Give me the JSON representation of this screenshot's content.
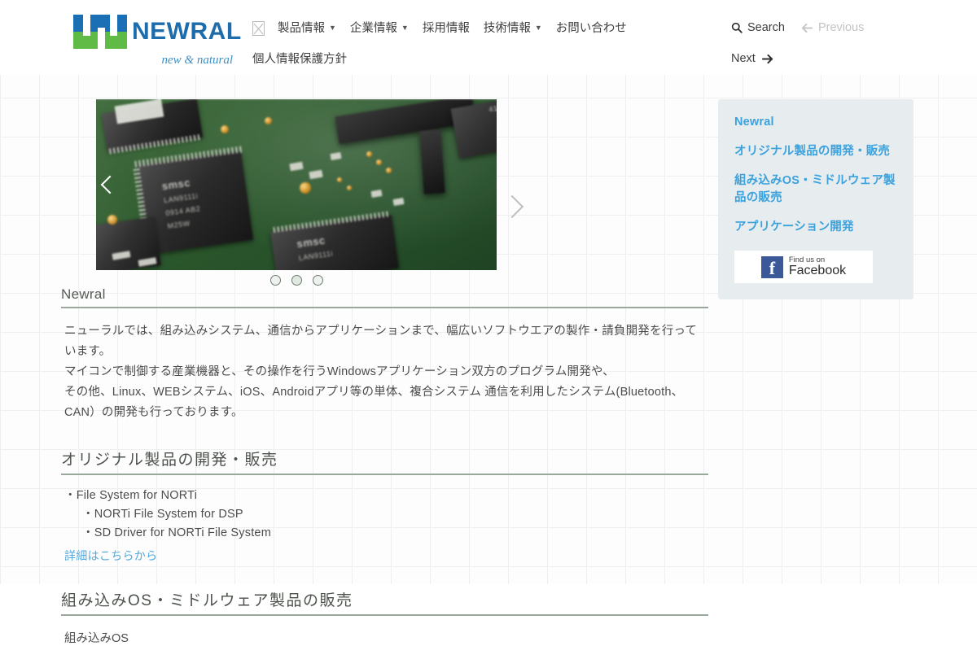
{
  "brand": {
    "wordmark": "NEWRAL",
    "tagline": "new & natural"
  },
  "nav": {
    "placeholder_icon": "broken-image-icon",
    "items_row1": [
      {
        "label": "製品情報",
        "has_caret": true
      },
      {
        "label": "企業情報",
        "has_caret": true
      },
      {
        "label": "採用情報",
        "has_caret": false
      },
      {
        "label": "技術情報",
        "has_caret": true
      },
      {
        "label": "お問い合わせ",
        "has_caret": false
      }
    ],
    "items_row2": [
      {
        "label": "個人情報保護方針",
        "has_caret": false
      }
    ]
  },
  "header_utils": {
    "search_label": "Search",
    "search_icon": "search-icon",
    "previous_label": "Previous",
    "previous_icon": "arrow-left-icon",
    "previous_disabled": true,
    "next_label": "Next",
    "next_icon": "arrow-right-icon"
  },
  "carousel": {
    "prev_icon": "chevron-left-icon",
    "next_icon": "chevron-right-icon",
    "slide_count": 3,
    "active_slide": 2,
    "image_alt": "プリント基板 SMSC チップ"
  },
  "main": {
    "section1": {
      "title": "Newral",
      "paragraphs": [
        "ニューラルでは、組み込みシステム、通信からアプリケーションまで、幅広いソフトウエアの製作・請負開発を行っています。",
        "マイコンで制御する産業機器と、その操作を行うWindowsアプリケーション双方のプログラム開発や、",
        "その他、Linux、WEBシステム、iOS、Androidアプリ等の単体、複合システム 通信を利用したシステム(Bluetooth、CAN）の開発も行っております。"
      ]
    },
    "section2": {
      "title": "オリジナル製品の開発・販売",
      "items": [
        {
          "text": "・File System for NORTi",
          "indent": false
        },
        {
          "text": "・NORTi File System for DSP",
          "indent": true
        },
        {
          "text": "・SD Driver for NORTi File System",
          "indent": true
        }
      ],
      "link_label": "詳細はこちらから"
    },
    "section3": {
      "title": "組み込みOS・ミドルウェア製品の販売",
      "body": "組み込みOS"
    }
  },
  "sidebar": {
    "links": [
      "Newral",
      "オリジナル製品の開発・販売",
      "組み込みOS・ミドルウェア製品の販売",
      "アプリケーション開発"
    ],
    "facebook": {
      "small_text": "Find us on",
      "big_text": "Facebook",
      "icon": "facebook-icon"
    }
  },
  "colors": {
    "logo_blue": "#1a6fb5",
    "logo_green": "#5fba46",
    "wordmark_blue": "#1d6cab",
    "link_blue": "#3ba2dd",
    "sidebar_bg": "#e7ecef",
    "rule_green": "#9aa89a",
    "facebook_blue": "#3b5998"
  }
}
